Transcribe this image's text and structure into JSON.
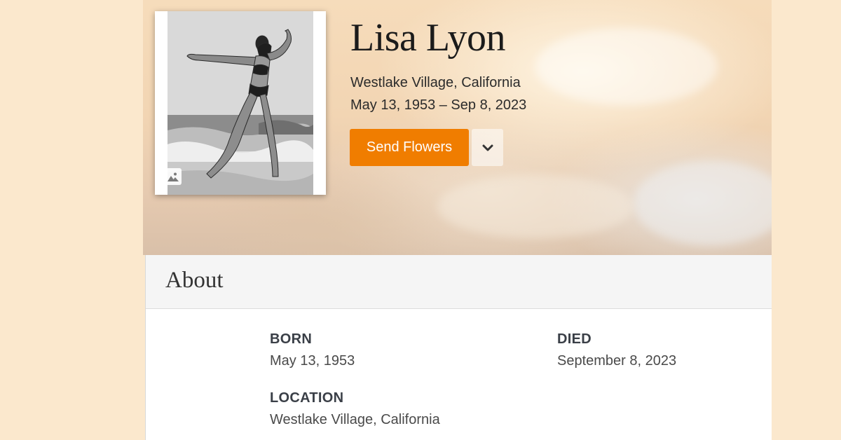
{
  "profile": {
    "name": "Lisa Lyon",
    "location": "Westlake Village, California",
    "dates": "May 13, 1953 – Sep 8, 2023"
  },
  "actions": {
    "send_flowers_label": "Send Flowers",
    "more_icon": "chevron-down-icon"
  },
  "about": {
    "title": "About",
    "born_label": "BORN",
    "born_value": "May 13, 1953",
    "died_label": "DIED",
    "died_value": "September 8, 2023",
    "location_label": "LOCATION",
    "location_value": "Westlake Village, California"
  },
  "colors": {
    "accent": "#f07d00",
    "page_background": "#fbe8cd"
  }
}
